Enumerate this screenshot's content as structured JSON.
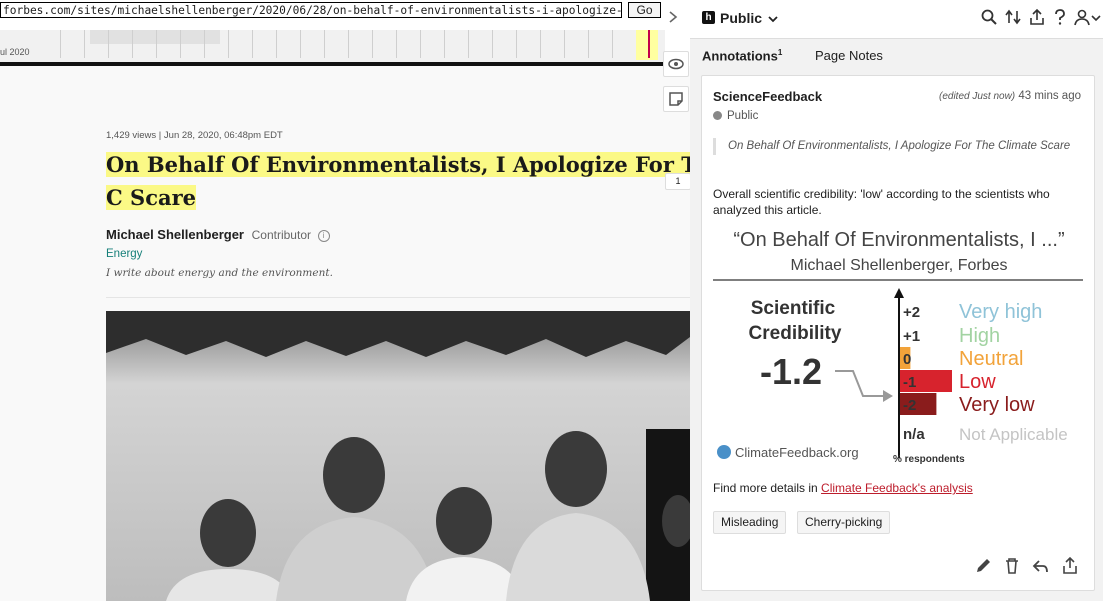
{
  "browser": {
    "url": "forbes.com/sites/michaelshellenberger/2020/06/28/on-behalf-of-environmentalists-i-apologize-for-th",
    "go_label": "Go"
  },
  "timeline": {
    "date_label": "ul 2020"
  },
  "article": {
    "meta": "1,429 views  |  Jun 28, 2020, 06:48pm EDT",
    "title": "On Behalf Of Environmentalists, I Apologize For The C Scare",
    "author_name": "Michael Shellenberger",
    "author_role": "Contributor",
    "topic": "Energy",
    "bio": "I write about energy and the environment.",
    "annotation_count": "1"
  },
  "sidebar": {
    "group_label": "Public",
    "tabs": [
      {
        "label": "Annotations",
        "count": "1"
      },
      {
        "label": "Page Notes"
      }
    ],
    "annotation": {
      "user": "ScienceFeedback",
      "edited": "(edited Just now)",
      "time": "43 mins ago",
      "privacy": "Public",
      "quote": "On Behalf Of Environmentalists, I Apologize For The Climate Scare",
      "body": "Overall scientific credibility: 'low' according to the scientists who analyzed this article.",
      "details_prefix": "Find more details in ",
      "details_link": "Climate Feedback's analysis",
      "tags": [
        "Misleading",
        "Cherry-picking"
      ]
    }
  },
  "credibility_graphic": {
    "title": "“On Behalf Of Environmentalists, I ...”",
    "subtitle": "Michael Shellenberger, Forbes",
    "label_line1": "Scientific",
    "label_line2": "Credibility",
    "score": "-1.2",
    "scale": [
      {
        "value": "+2",
        "label": "Very high",
        "color": "#8fc3d8"
      },
      {
        "value": "+1",
        "label": "High",
        "color": "#a2d3a2"
      },
      {
        "value": "0",
        "label": "Neutral",
        "color": "#f2a33a"
      },
      {
        "value": "-1",
        "label": "Low",
        "color": "#d7232d"
      },
      {
        "value": "-2",
        "label": "Very low",
        "color": "#8a1c1c"
      },
      {
        "value": "n/a",
        "label": "Not Applicable",
        "color": "#c4c4c4"
      }
    ],
    "axis_label": "% respondents",
    "brand": "ClimateFeedback.org",
    "response_shares": {
      "0": 0.2,
      "-1": 1.0,
      "-2": 0.7
    }
  }
}
